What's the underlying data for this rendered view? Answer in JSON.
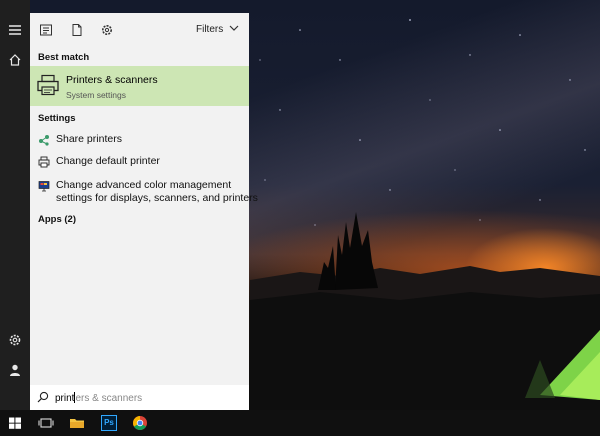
{
  "search": {
    "typed": "print",
    "suggestion_rest": "ers & scanners"
  },
  "panel": {
    "top_icons": [
      "document-list-icon",
      "document-icon",
      "gear-icon"
    ],
    "filters_label": "Filters",
    "best_match_heading": "Best match",
    "best_match": {
      "title": "Printers & scanners",
      "subtitle": "System settings"
    },
    "settings_heading": "Settings",
    "settings_items": [
      {
        "label": "Share printers",
        "icon": "share-printers-icon"
      },
      {
        "label": "Change default printer",
        "icon": "printer-icon"
      },
      {
        "label_line1": "Change advanced color management",
        "label_line2": "settings for displays, scanners, and printers",
        "icon": "color-management-icon"
      }
    ],
    "apps_heading": "Apps (2)"
  },
  "sidebar": {
    "icons": [
      "hamburger-menu-icon",
      "home-icon",
      "settings-gear-icon",
      "user-icon"
    ]
  },
  "taskbar": {
    "icons": [
      "windows-start-icon",
      "task-view-icon",
      "file-explorer-icon",
      "photoshop-icon",
      "chrome-icon"
    ],
    "photoshop_label": "Ps"
  },
  "colors": {
    "best_match_bg": "#cde6b4",
    "panel_bg": "#f2f2f2",
    "sidebar_bg": "#1f1f1f",
    "taskbar_bg": "#101010"
  }
}
